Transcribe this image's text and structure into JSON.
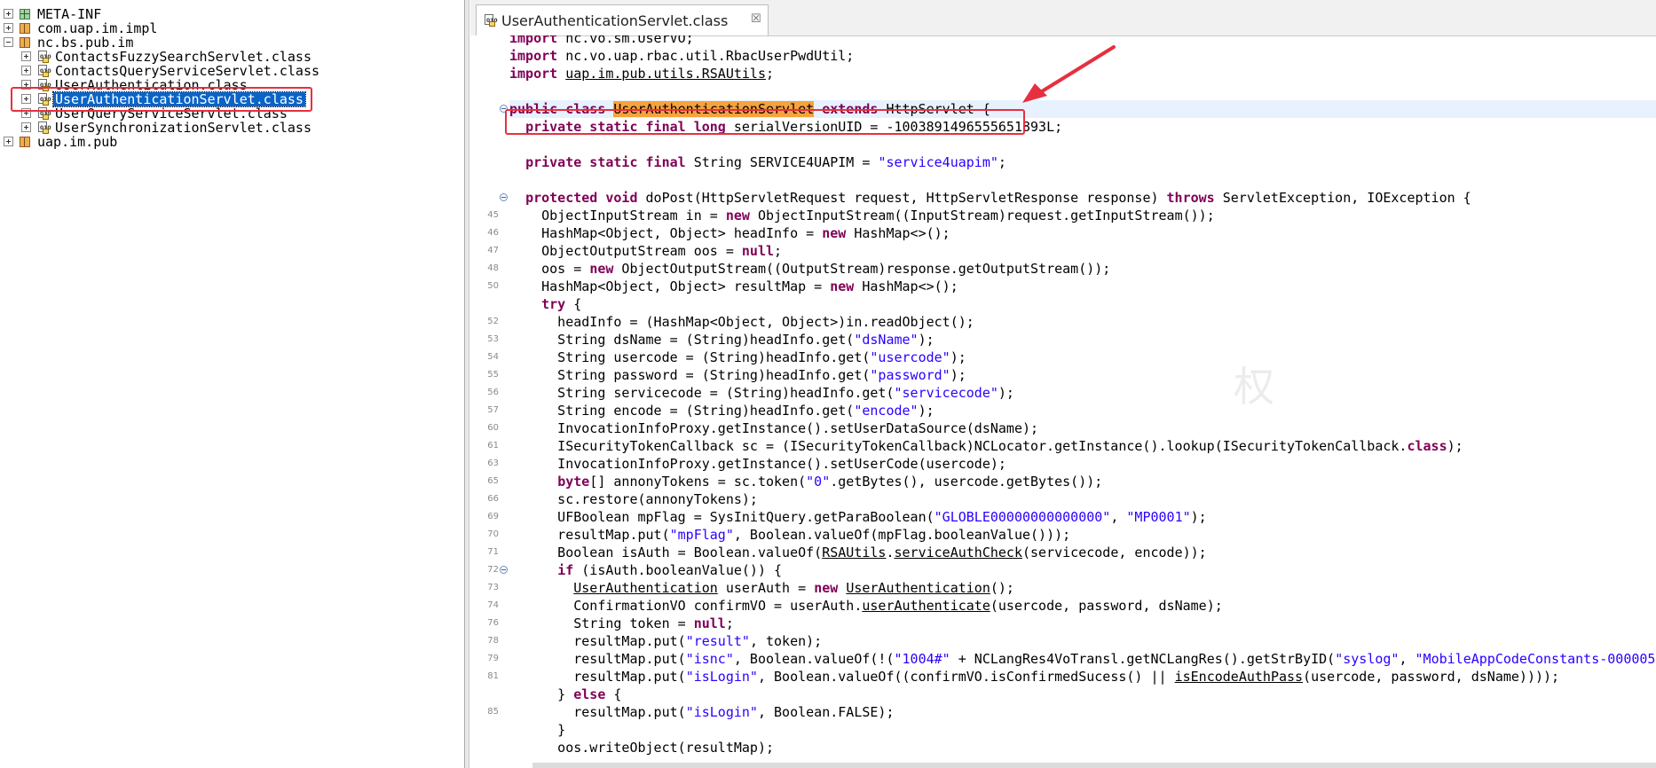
{
  "package_tree": {
    "items": [
      {
        "label": "META-INF",
        "type": "meta",
        "indent": 0,
        "expander": "plus"
      },
      {
        "label": "com.uap.im.impl",
        "type": "package",
        "indent": 0,
        "expander": "plus"
      },
      {
        "label": "nc.bs.pub.im",
        "type": "package",
        "indent": 0,
        "expander": "minus"
      },
      {
        "label": "ContactsFuzzySearchServlet.class",
        "type": "class",
        "indent": 1,
        "expander": "plus"
      },
      {
        "label": "ContactsQueryServiceServlet.class",
        "type": "class",
        "indent": 1,
        "expander": "plus"
      },
      {
        "label": "UserAuthentication.class",
        "type": "class",
        "indent": 1,
        "expander": "plus"
      },
      {
        "label": "UserAuthenticationServlet.class",
        "type": "class",
        "indent": 1,
        "expander": "plus",
        "selected": true
      },
      {
        "label": "UserQueryServiceServlet.class",
        "type": "class",
        "indent": 1,
        "expander": "plus"
      },
      {
        "label": "UserSynchronizationServlet.class",
        "type": "class",
        "indent": 1,
        "expander": "plus"
      },
      {
        "label": "uap.im.pub",
        "type": "package",
        "indent": 0,
        "expander": "plus"
      }
    ]
  },
  "editor": {
    "tab_title": "UserAuthenticationServlet.class",
    "tab_close_glyph": "☒",
    "watermark": "权",
    "lines": [
      {
        "n": "",
        "fold": false,
        "html": "<span class=\"kw\">import</span> nc.vo.sm.UserVO;"
      },
      {
        "n": "",
        "fold": false,
        "html": "<span class=\"kw\">import</span> nc.vo.uap.rbac.util.RbacUserPwdUtil;"
      },
      {
        "n": "",
        "fold": false,
        "html": "<span class=\"kw\">import</span> <span class=\"und\">uap.im.pub.utils.RSAUtils</span>;"
      },
      {
        "n": "",
        "fold": false,
        "html": ""
      },
      {
        "n": "",
        "fold": true,
        "cur": true,
        "html": "<span class=\"kw\">public class</span> <span class=\"mark\">UserAuthenticationServlet</span> <span class=\"kw\">extends</span> HttpServlet {"
      },
      {
        "n": "",
        "fold": false,
        "html": "  <span class=\"kw\">private static final long</span> serialVersionUID = -1003891496555651893L;"
      },
      {
        "n": "",
        "fold": false,
        "html": ""
      },
      {
        "n": "",
        "fold": false,
        "html": "  <span class=\"kw\">private static final</span> String SERVICE4UAPIM = <span class=\"str\">\"service4uapim\"</span>;"
      },
      {
        "n": "",
        "fold": false,
        "html": ""
      },
      {
        "n": "",
        "fold": true,
        "html": "  <span class=\"kw\">protected void</span> doPost(HttpServletRequest request, HttpServletResponse response) <span class=\"kw\">throws</span> ServletException, IOException {"
      },
      {
        "n": "45",
        "fold": false,
        "html": "    ObjectInputStream in = <span class=\"kw\">new</span> ObjectInputStream((InputStream)request.getInputStream());"
      },
      {
        "n": "46",
        "fold": false,
        "html": "    HashMap&lt;Object, Object&gt; headInfo = <span class=\"kw\">new</span> HashMap&lt;&gt;();"
      },
      {
        "n": "47",
        "fold": false,
        "html": "    ObjectOutputStream oos = <span class=\"kw\">null</span>;"
      },
      {
        "n": "48",
        "fold": false,
        "html": "    oos = <span class=\"kw\">new</span> ObjectOutputStream((OutputStream)response.getOutputStream());"
      },
      {
        "n": "50",
        "fold": false,
        "html": "    HashMap&lt;Object, Object&gt; resultMap = <span class=\"kw\">new</span> HashMap&lt;&gt;();"
      },
      {
        "n": "",
        "fold": false,
        "html": "    <span class=\"kw\">try</span> {"
      },
      {
        "n": "52",
        "fold": false,
        "html": "      headInfo = (HashMap&lt;Object, Object&gt;)in.readObject();"
      },
      {
        "n": "53",
        "fold": false,
        "html": "      String dsName = (String)headInfo.get(<span class=\"str\">\"dsName\"</span>);"
      },
      {
        "n": "54",
        "fold": false,
        "html": "      String usercode = (String)headInfo.get(<span class=\"str\">\"usercode\"</span>);"
      },
      {
        "n": "55",
        "fold": false,
        "html": "      String password = (String)headInfo.get(<span class=\"str\">\"password\"</span>);"
      },
      {
        "n": "56",
        "fold": false,
        "html": "      String servicecode = (String)headInfo.get(<span class=\"str\">\"servicecode\"</span>);"
      },
      {
        "n": "57",
        "fold": false,
        "html": "      String encode = (String)headInfo.get(<span class=\"str\">\"encode\"</span>);"
      },
      {
        "n": "60",
        "fold": false,
        "html": "      InvocationInfoProxy.getInstance().setUserDataSource(dsName);"
      },
      {
        "n": "61",
        "fold": false,
        "html": "      ISecurityTokenCallback sc = (ISecurityTokenCallback)NCLocator.getInstance().lookup(ISecurityTokenCallback.<span class=\"kw\">class</span>);"
      },
      {
        "n": "63",
        "fold": false,
        "html": "      InvocationInfoProxy.getInstance().setUserCode(usercode);"
      },
      {
        "n": "65",
        "fold": false,
        "html": "      <span class=\"kw\">byte</span>[] annonyTokens = sc.token(<span class=\"str\">\"0\"</span>.getBytes(), usercode.getBytes());"
      },
      {
        "n": "66",
        "fold": false,
        "html": "      sc.restore(annonyTokens);"
      },
      {
        "n": "69",
        "fold": false,
        "html": "      UFBoolean mpFlag = SysInitQuery.getParaBoolean(<span class=\"str\">\"GLOBLE00000000000000\"</span>, <span class=\"str\">\"MP0001\"</span>);"
      },
      {
        "n": "70",
        "fold": false,
        "html": "      resultMap.put(<span class=\"str\">\"mpFlag\"</span>, Boolean.valueOf(mpFlag.booleanValue()));"
      },
      {
        "n": "71",
        "fold": false,
        "html": "      Boolean isAuth = Boolean.valueOf(<span class=\"und\">RSAUtils</span>.<span class=\"und\">serviceAuthCheck</span>(servicecode, encode));"
      },
      {
        "n": "72",
        "fold": true,
        "html": "      <span class=\"kw\">if</span> (isAuth.booleanValue()) {"
      },
      {
        "n": "73",
        "fold": false,
        "html": "        <span class=\"und\">UserAuthentication</span> userAuth = <span class=\"kw\">new</span> <span class=\"und\">UserAuthentication</span>();"
      },
      {
        "n": "74",
        "fold": false,
        "html": "        ConfirmationVO confirmVO = userAuth.<span class=\"und\">userAuthenticate</span>(usercode, password, dsName);"
      },
      {
        "n": "76",
        "fold": false,
        "html": "        String token = <span class=\"kw\">null</span>;"
      },
      {
        "n": "78",
        "fold": false,
        "html": "        resultMap.put(<span class=\"str\">\"result\"</span>, token);"
      },
      {
        "n": "79",
        "fold": false,
        "html": "        resultMap.put(<span class=\"str\">\"isnc\"</span>, Boolean.valueOf(!(<span class=\"str\">\"1004#\"</span> + NCLangRes4VoTransl.getNCLangRes().getStrByID(<span class=\"str\">\"syslog\"</span>, <span class=\"str\">\"MobileAppCodeConstants-000005\"</span>"
      },
      {
        "n": "81",
        "fold": false,
        "html": "        resultMap.put(<span class=\"str\">\"isLogin\"</span>, Boolean.valueOf((confirmVO.isConfirmedSucess() || <span class=\"und\">isEncodeAuthPass</span>(usercode, password, dsName))));"
      },
      {
        "n": "",
        "fold": false,
        "html": "      } <span class=\"kw\">else</span> {"
      },
      {
        "n": "85",
        "fold": false,
        "html": "        resultMap.put(<span class=\"str\">\"isLogin\"</span>, Boolean.FALSE);"
      },
      {
        "n": "",
        "fold": false,
        "html": "      }"
      },
      {
        "n": "",
        "fold": false,
        "html": "      oos.writeObject(resultMap);"
      }
    ]
  },
  "colors": {
    "annotation_red": "#e7303f",
    "selection_blue": "#0a64c8",
    "keyword": "#7f0055",
    "string": "#2a00ff",
    "match_highlight": "#f7a23e"
  }
}
